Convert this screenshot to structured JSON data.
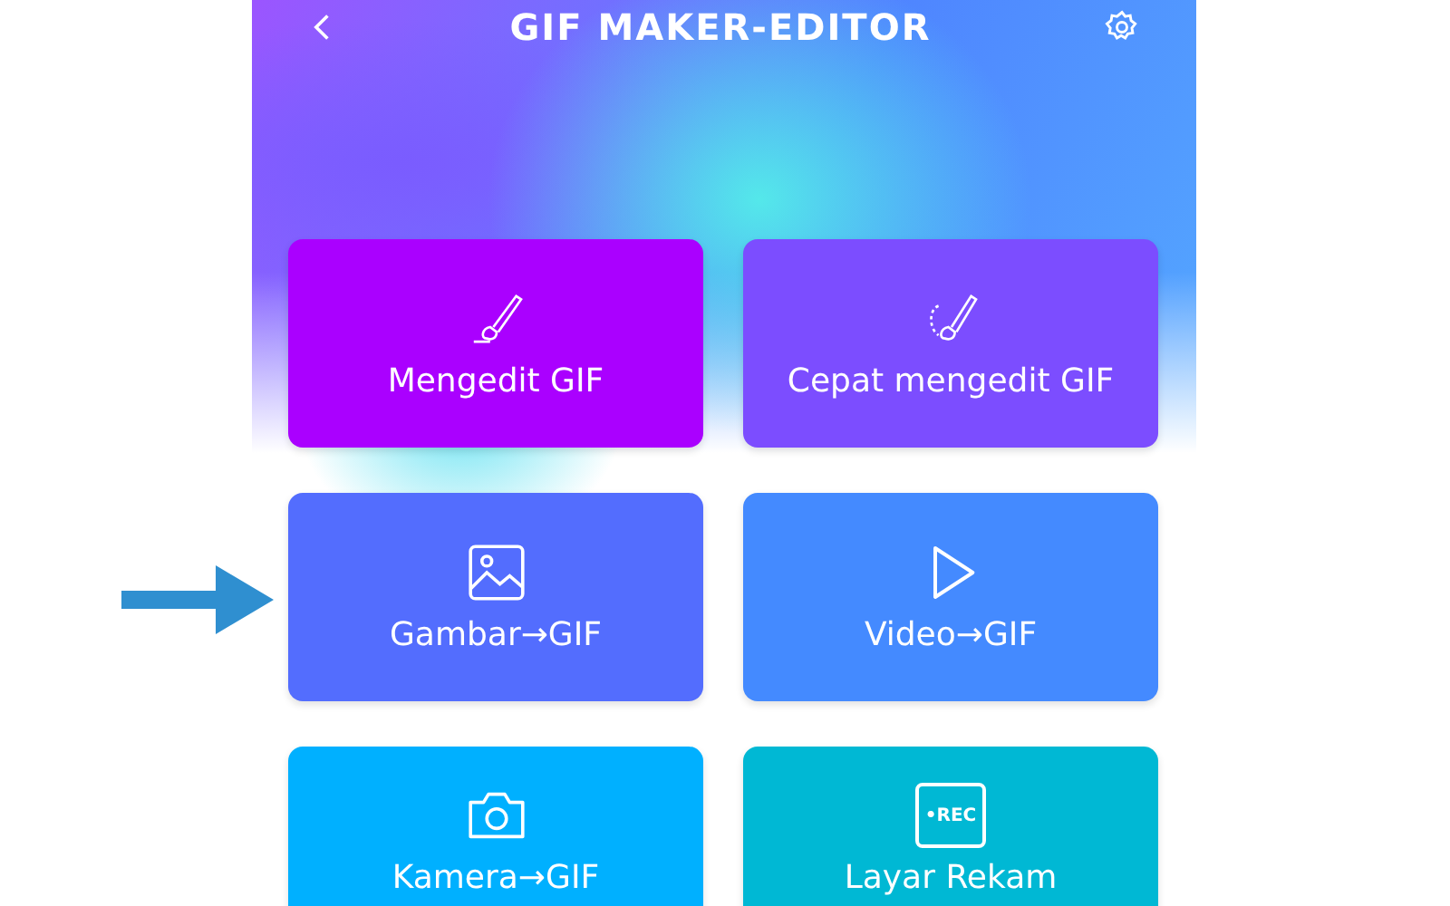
{
  "header": {
    "title": "GIF MAKER-EDITOR"
  },
  "tiles": [
    {
      "kind": "edit",
      "label": "Mengedit GIF",
      "color": "#aa00ff"
    },
    {
      "kind": "quick-edit",
      "label": "Cepat mengedit GIF",
      "color": "#7c4dff"
    },
    {
      "kind": "image",
      "label": "Gambar→GIF",
      "color": "#536dfe"
    },
    {
      "kind": "video",
      "label": "Video→GIF",
      "color": "#448aff"
    },
    {
      "kind": "camera",
      "label": "Kamera→GIF",
      "color": "#00b0ff"
    },
    {
      "kind": "record",
      "label": "Layar Rekam",
      "color": "#00b8d4"
    }
  ],
  "record_icon_text": "•REC"
}
